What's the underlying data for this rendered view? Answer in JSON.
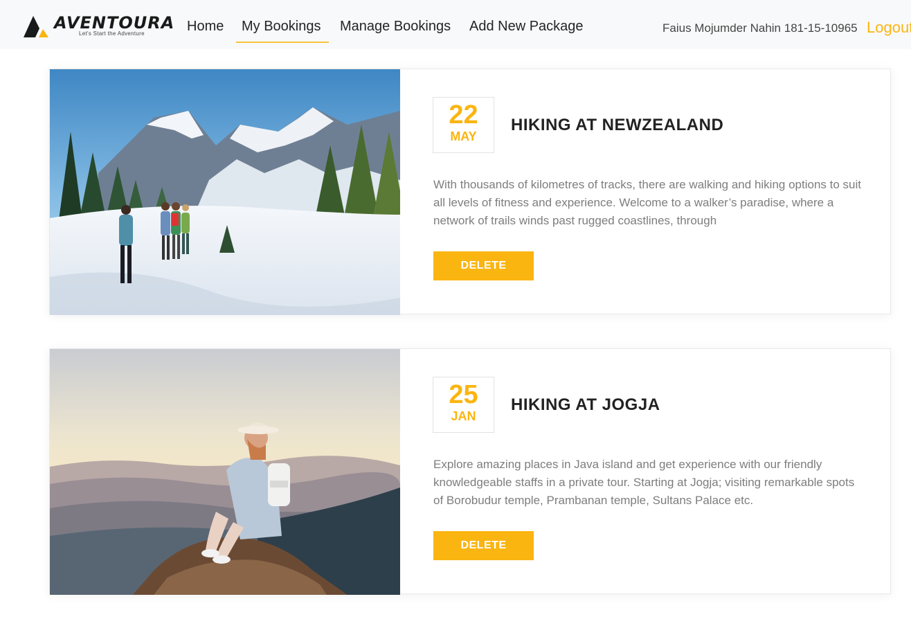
{
  "brand": {
    "name": "AVENTOURA",
    "tagline": "Let's Start the Adventure",
    "accent_color": "#fbb511"
  },
  "nav": {
    "home": "Home",
    "my_bookings": "My Bookings",
    "manage_bookings": "Manage Bookings",
    "add_package": "Add New Package",
    "active": "My Bookings"
  },
  "user": {
    "name": "Faius Mojumder Nahin 181-15-10965",
    "logout": "Logout"
  },
  "bookings": [
    {
      "day": "22",
      "month": "MAY",
      "title": "HIKING AT NEWZEALAND",
      "description": "With thousands of kilometres of tracks, there are walking and hiking options to suit all levels of fitness and experience. Welcome to a walker’s paradise, where a network of trails winds past rugged coastlines, through",
      "delete_label": "DELETE",
      "image": "snowy-mountain-hikers-photo"
    },
    {
      "day": "25",
      "month": "JAN",
      "title": "HIKING AT JOGJA",
      "description": "Explore amazing places in Java island and get experience with our friendly knowledgeable staffs in a private tour. Starting at Jogja; visiting remarkable spots of Borobudur temple, Prambanan temple, Sultans Palace etc.",
      "delete_label": "DELETE",
      "image": "woman-sitting-on-rock-sunset-photo"
    }
  ]
}
